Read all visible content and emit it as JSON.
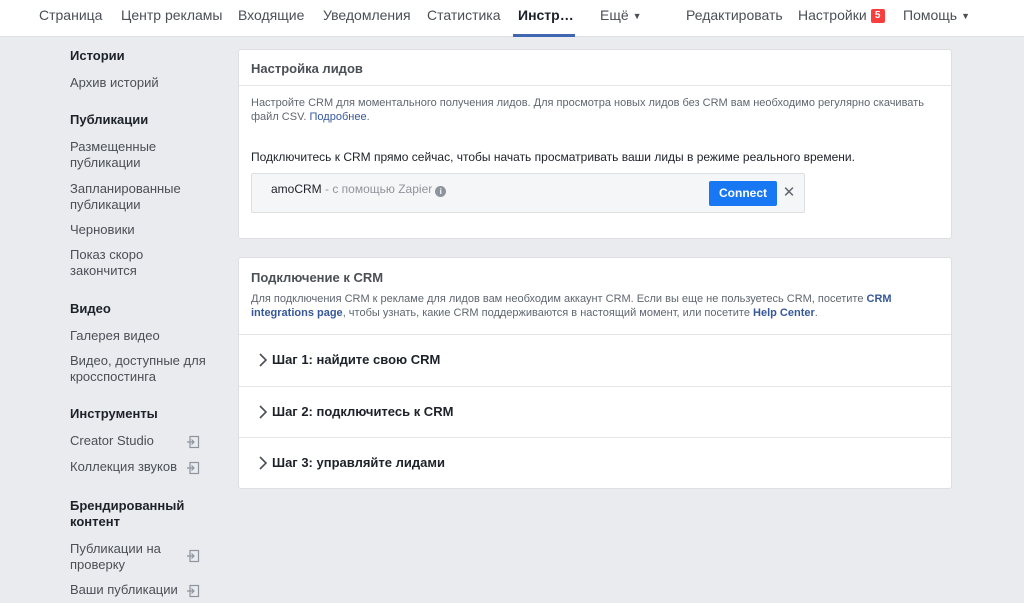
{
  "nav": {
    "tabs": [
      {
        "label": "Страница"
      },
      {
        "label": "Центр рекламы"
      },
      {
        "label": "Входящие"
      },
      {
        "label": "Уведомления"
      },
      {
        "label": "Статистика"
      },
      {
        "label": "Инстр…"
      },
      {
        "label": "Ещё"
      }
    ],
    "right": {
      "edit": "Редактировать",
      "settings": "Настройки",
      "settings_badge": "5",
      "help": "Помощь"
    },
    "active_color": "#4267b2"
  },
  "sidebar": {
    "sections": [
      {
        "title": "Истории",
        "items": [
          "Архив историй"
        ]
      },
      {
        "title": "Публикации",
        "items": [
          "Размещенные публикации",
          "Запланированные публикации",
          "Черновики",
          "Показ скоро закончится"
        ]
      },
      {
        "title": "Видео",
        "items": [
          "Галерея видео",
          "Видео, доступные для кросспостинга"
        ]
      },
      {
        "title": "Инструменты",
        "items": [
          "Creator Studio",
          "Коллекция звуков"
        ]
      },
      {
        "title": "Брендированный контент",
        "items": [
          "Публикации на проверку",
          "Ваши публикации"
        ]
      }
    ]
  },
  "leads_card": {
    "title": "Настройка лидов",
    "desc": "Настройте CRM для моментального получения лидов. Для просмотра новых лидов без CRM вам необходимо регулярно скачивать файл CSV.",
    "more_link": "Подробнее",
    "intro": "Подключитесь к CRM прямо сейчас, чтобы начать просматривать ваши лиды в режиме реального времени.",
    "crm_name": "amoCRM",
    "crm_via": " - с помощью Zapier",
    "connect_label": "Connect",
    "close_glyph": "✕"
  },
  "crm_card": {
    "title": "Подключение к CRM",
    "desc_1": "Для подключения CRM к рекламе для лидов вам необходим аккаунт CRM. Если вы еще не пользуетесь CRM, посетите",
    "link_integrations": "CRM integrations page",
    "desc_2": ", чтобы узнать, какие CRM поддерживаются в настоящий момент, или посетите",
    "link_help": "Help Center",
    "desc_3": ".",
    "steps": [
      {
        "label": "Шаг 1: найдите свою CRM"
      },
      {
        "label": "Шаг 2: подключитесь к CRM"
      },
      {
        "label": "Шаг 3: управляйте лидами"
      }
    ]
  },
  "colors": {
    "page_bg": "#e9ebee",
    "link": "#365899",
    "button": "#1877f2",
    "badge": "#fa3e3e"
  }
}
